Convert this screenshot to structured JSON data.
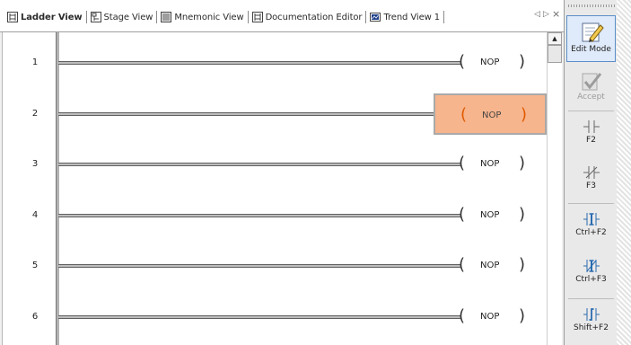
{
  "tabs": [
    {
      "label": "Ladder View",
      "icon": "ladder-view-icon",
      "active": true
    },
    {
      "label": "Stage View",
      "icon": "stage-view-icon",
      "active": false
    },
    {
      "label": "Mnemonic View",
      "icon": "mnemonic-view-icon",
      "active": false
    },
    {
      "label": "Documentation Editor",
      "icon": "documentation-editor-icon",
      "active": false
    },
    {
      "label": "Trend View 1",
      "icon": "trend-view-icon",
      "active": false
    }
  ],
  "tab_controls": {
    "prev": "◁",
    "next": "▷",
    "close": "×"
  },
  "rungs": [
    {
      "number": "1",
      "instruction": "NOP",
      "coil_open": "(",
      "coil_close": ")",
      "selected": false
    },
    {
      "number": "2",
      "instruction": "NOP",
      "coil_open": "(",
      "coil_close": ")",
      "selected": true
    },
    {
      "number": "3",
      "instruction": "NOP",
      "coil_open": "(",
      "coil_close": ")",
      "selected": false
    },
    {
      "number": "4",
      "instruction": "NOP",
      "coil_open": "(",
      "coil_close": ")",
      "selected": false
    },
    {
      "number": "5",
      "instruction": "NOP",
      "coil_open": "(",
      "coil_close": ")",
      "selected": false
    },
    {
      "number": "6",
      "instruction": "NOP",
      "coil_open": "(",
      "coil_close": ")",
      "selected": false
    }
  ],
  "palette": {
    "edit_mode": {
      "label": "Edit Mode",
      "icon": "edit-mode-icon",
      "active": true
    },
    "accept": {
      "label": "Accept",
      "icon": "accept-checkmark-icon",
      "enabled": false
    },
    "tools": [
      {
        "label": "F2",
        "icon": "normally-open-contact-icon"
      },
      {
        "label": "F3",
        "icon": "normally-closed-contact-icon"
      },
      {
        "label": "Ctrl+F2",
        "icon": "open-branch-contact-icon"
      },
      {
        "label": "Ctrl+F3",
        "icon": "closed-branch-contact-icon"
      },
      {
        "label": "Shift+F2",
        "icon": "rising-edge-contact-icon"
      }
    ]
  },
  "colors": {
    "selection_fill": "#f7b58d",
    "selection_glyph": "#e05a00",
    "palette_active": "#dfeafa",
    "rail": "#b3b3b3"
  }
}
